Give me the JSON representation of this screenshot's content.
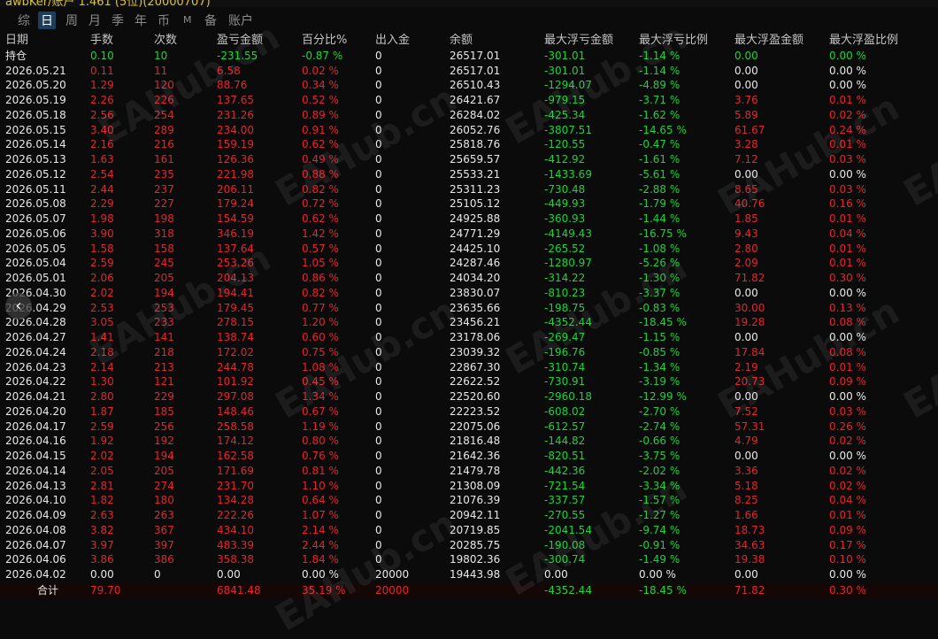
{
  "header": {
    "title": "awbKer/账户 1.461 (5位)(20000707)"
  },
  "tabs": [
    {
      "label": "综",
      "active": false,
      "small": false
    },
    {
      "label": "日",
      "active": true,
      "small": false
    },
    {
      "label": "周",
      "active": false,
      "small": false
    },
    {
      "label": "月",
      "active": false,
      "small": false
    },
    {
      "label": "季",
      "active": false,
      "small": false
    },
    {
      "label": "年",
      "active": false,
      "small": false
    },
    {
      "label": "币",
      "active": false,
      "small": false
    },
    {
      "label": "M",
      "active": false,
      "small": true
    },
    {
      "label": "备",
      "active": false,
      "small": false
    },
    {
      "label": "账户",
      "active": false,
      "small": false
    }
  ],
  "columns": [
    "日期",
    "手数",
    "次数",
    "盈亏金额",
    "百分比%",
    "出入金",
    "余额",
    "最大浮亏金额",
    "最大浮亏比例",
    "最大浮盈金额",
    "最大浮盈比例"
  ],
  "rows": [
    [
      "持仓",
      "0.10",
      "10",
      "-231.55",
      "-0.87 %",
      "0",
      "26517.01",
      "-301.01",
      "-1.14 %",
      "0.00",
      "0.00 %"
    ],
    [
      "2026.05.21",
      "0.11",
      "11",
      "6.58",
      "0.02 %",
      "0",
      "26517.01",
      "-301.01",
      "-1.14 %",
      "0.00",
      "0.00 %"
    ],
    [
      "2026.05.20",
      "1.29",
      "120",
      "88.76",
      "0.34 %",
      "0",
      "26510.43",
      "-1294.07",
      "-4.89 %",
      "0.00",
      "0.00 %"
    ],
    [
      "2026.05.19",
      "2.26",
      "226",
      "137.65",
      "0.52 %",
      "0",
      "26421.67",
      "-979.15",
      "-3.71 %",
      "3.76",
      "0.01 %"
    ],
    [
      "2026.05.18",
      "2.56",
      "254",
      "231.26",
      "0.89 %",
      "0",
      "26284.02",
      "-425.34",
      "-1.62 %",
      "5.89",
      "0.02 %"
    ],
    [
      "2026.05.15",
      "3.40",
      "289",
      "234.00",
      "0.91 %",
      "0",
      "26052.76",
      "-3807.51",
      "-14.65 %",
      "61.67",
      "0.24 %"
    ],
    [
      "2026.05.14",
      "2.16",
      "216",
      "159.19",
      "0.62 %",
      "0",
      "25818.76",
      "-120.55",
      "-0.47 %",
      "3.28",
      "0.01 %"
    ],
    [
      "2026.05.13",
      "1.63",
      "161",
      "126.36",
      "0.49 %",
      "0",
      "25659.57",
      "-412.92",
      "-1.61 %",
      "7.12",
      "0.03 %"
    ],
    [
      "2026.05.12",
      "2.54",
      "235",
      "221.98",
      "0.88 %",
      "0",
      "25533.21",
      "-1433.69",
      "-5.61 %",
      "0.00",
      "0.00 %"
    ],
    [
      "2026.05.11",
      "2.44",
      "237",
      "206.11",
      "0.82 %",
      "0",
      "25311.23",
      "-730.48",
      "-2.88 %",
      "8.65",
      "0.03 %"
    ],
    [
      "2026.05.08",
      "2.29",
      "227",
      "179.24",
      "0.72 %",
      "0",
      "25105.12",
      "-449.93",
      "-1.79 %",
      "40.76",
      "0.16 %"
    ],
    [
      "2026.05.07",
      "1.98",
      "198",
      "154.59",
      "0.62 %",
      "0",
      "24925.88",
      "-360.93",
      "-1.44 %",
      "1.85",
      "0.01 %"
    ],
    [
      "2026.05.06",
      "3.90",
      "318",
      "346.19",
      "1.42 %",
      "0",
      "24771.29",
      "-4149.43",
      "-16.75 %",
      "9.43",
      "0.04 %"
    ],
    [
      "2026.05.05",
      "1.58",
      "158",
      "137.64",
      "0.57 %",
      "0",
      "24425.10",
      "-265.52",
      "-1.08 %",
      "2.80",
      "0.01 %"
    ],
    [
      "2026.05.04",
      "2.59",
      "245",
      "253.26",
      "1.05 %",
      "0",
      "24287.46",
      "-1280.97",
      "-5.26 %",
      "2.09",
      "0.01 %"
    ],
    [
      "2026.05.01",
      "2.06",
      "205",
      "204.13",
      "0.86 %",
      "0",
      "24034.20",
      "-314.22",
      "-1.30 %",
      "71.82",
      "0.30 %"
    ],
    [
      "2026.04.30",
      "2.02",
      "194",
      "194.41",
      "0.82 %",
      "0",
      "23830.07",
      "-810.23",
      "-3.37 %",
      "0.00",
      "0.00 %"
    ],
    [
      "2026.04.29",
      "2.53",
      "253",
      "179.45",
      "0.77 %",
      "0",
      "23635.66",
      "-198.75",
      "-0.83 %",
      "30.00",
      "0.13 %"
    ],
    [
      "2026.04.28",
      "3.05",
      "233",
      "278.15",
      "1.20 %",
      "0",
      "23456.21",
      "-4352.44",
      "-18.45 %",
      "19.28",
      "0.08 %"
    ],
    [
      "2026.04.27",
      "1.41",
      "141",
      "138.74",
      "0.60 %",
      "0",
      "23178.06",
      "-269.47",
      "-1.15 %",
      "0.00",
      "0.00 %"
    ],
    [
      "2026.04.24",
      "2.18",
      "218",
      "172.02",
      "0.75 %",
      "0",
      "23039.32",
      "-196.76",
      "-0.85 %",
      "17.84",
      "0.08 %"
    ],
    [
      "2026.04.23",
      "2.14",
      "213",
      "244.78",
      "1.08 %",
      "0",
      "22867.30",
      "-310.74",
      "-1.34 %",
      "2.19",
      "0.01 %"
    ],
    [
      "2026.04.22",
      "1.30",
      "121",
      "101.92",
      "0.45 %",
      "0",
      "22622.52",
      "-730.91",
      "-3.19 %",
      "20.73",
      "0.09 %"
    ],
    [
      "2026.04.21",
      "2.80",
      "229",
      "297.08",
      "1.34 %",
      "0",
      "22520.60",
      "-2960.18",
      "-12.99 %",
      "0.00",
      "0.00 %"
    ],
    [
      "2026.04.20",
      "1.87",
      "185",
      "148.46",
      "0.67 %",
      "0",
      "22223.52",
      "-608.02",
      "-2.70 %",
      "7.52",
      "0.03 %"
    ],
    [
      "2026.04.17",
      "2.59",
      "256",
      "258.58",
      "1.19 %",
      "0",
      "22075.06",
      "-612.57",
      "-2.74 %",
      "57.31",
      "0.26 %"
    ],
    [
      "2026.04.16",
      "1.92",
      "192",
      "174.12",
      "0.80 %",
      "0",
      "21816.48",
      "-144.82",
      "-0.66 %",
      "4.79",
      "0.02 %"
    ],
    [
      "2026.04.15",
      "2.02",
      "194",
      "162.58",
      "0.76 %",
      "0",
      "21642.36",
      "-820.51",
      "-3.75 %",
      "0.00",
      "0.00 %"
    ],
    [
      "2026.04.14",
      "2.05",
      "205",
      "171.69",
      "0.81 %",
      "0",
      "21479.78",
      "-442.36",
      "-2.02 %",
      "3.36",
      "0.02 %"
    ],
    [
      "2026.04.13",
      "2.81",
      "274",
      "231.70",
      "1.10 %",
      "0",
      "21308.09",
      "-721.54",
      "-3.34 %",
      "5.18",
      "0.02 %"
    ],
    [
      "2026.04.10",
      "1.82",
      "180",
      "134.28",
      "0.64 %",
      "0",
      "21076.39",
      "-337.57",
      "-1.57 %",
      "8.25",
      "0.04 %"
    ],
    [
      "2026.04.09",
      "2.63",
      "263",
      "222.26",
      "1.07 %",
      "0",
      "20942.11",
      "-270.55",
      "-1.27 %",
      "1.66",
      "0.01 %"
    ],
    [
      "2026.04.08",
      "3.82",
      "367",
      "434.10",
      "2.14 %",
      "0",
      "20719.85",
      "-2041.54",
      "-9.74 %",
      "18.73",
      "0.09 %"
    ],
    [
      "2026.04.07",
      "3.97",
      "397",
      "483.39",
      "2.44 %",
      "0",
      "20285.75",
      "-190.08",
      "-0.91 %",
      "34.63",
      "0.17 %"
    ],
    [
      "2026.04.06",
      "3.86",
      "386",
      "358.38",
      "1.84 %",
      "0",
      "19802.36",
      "-300.74",
      "-1.49 %",
      "19.38",
      "0.10 %"
    ],
    [
      "2026.04.02",
      "0.00",
      "0",
      "0.00",
      "0.00 %",
      "20000",
      "19443.98",
      "0.00",
      "0.00 %",
      "0.00",
      "0.00 %"
    ]
  ],
  "totals": [
    "合计",
    "79.70",
    "",
    "6841.48",
    "35.19 %",
    "20000",
    "",
    "-4352.44",
    "-18.45 %",
    "71.82",
    "0.30 %"
  ],
  "colors": {
    "positive": "#e8232b",
    "negative": "#19d43a",
    "neutral": "#e8e8e8",
    "active_tab": "#1e3e5c"
  },
  "icons": {
    "prev_button": "chevron-left-icon"
  },
  "watermarks": [
    "EAHub.cn",
    "EAHub.cn",
    "EAHub.cn",
    "EAHub.cn",
    "EAHub.cn",
    "EAHub.cn",
    "EAHub.cn",
    "EAHub.cn",
    "EAHub.cn",
    "EAHub.cn",
    "EAHub.cn",
    "EAHub.cn"
  ]
}
